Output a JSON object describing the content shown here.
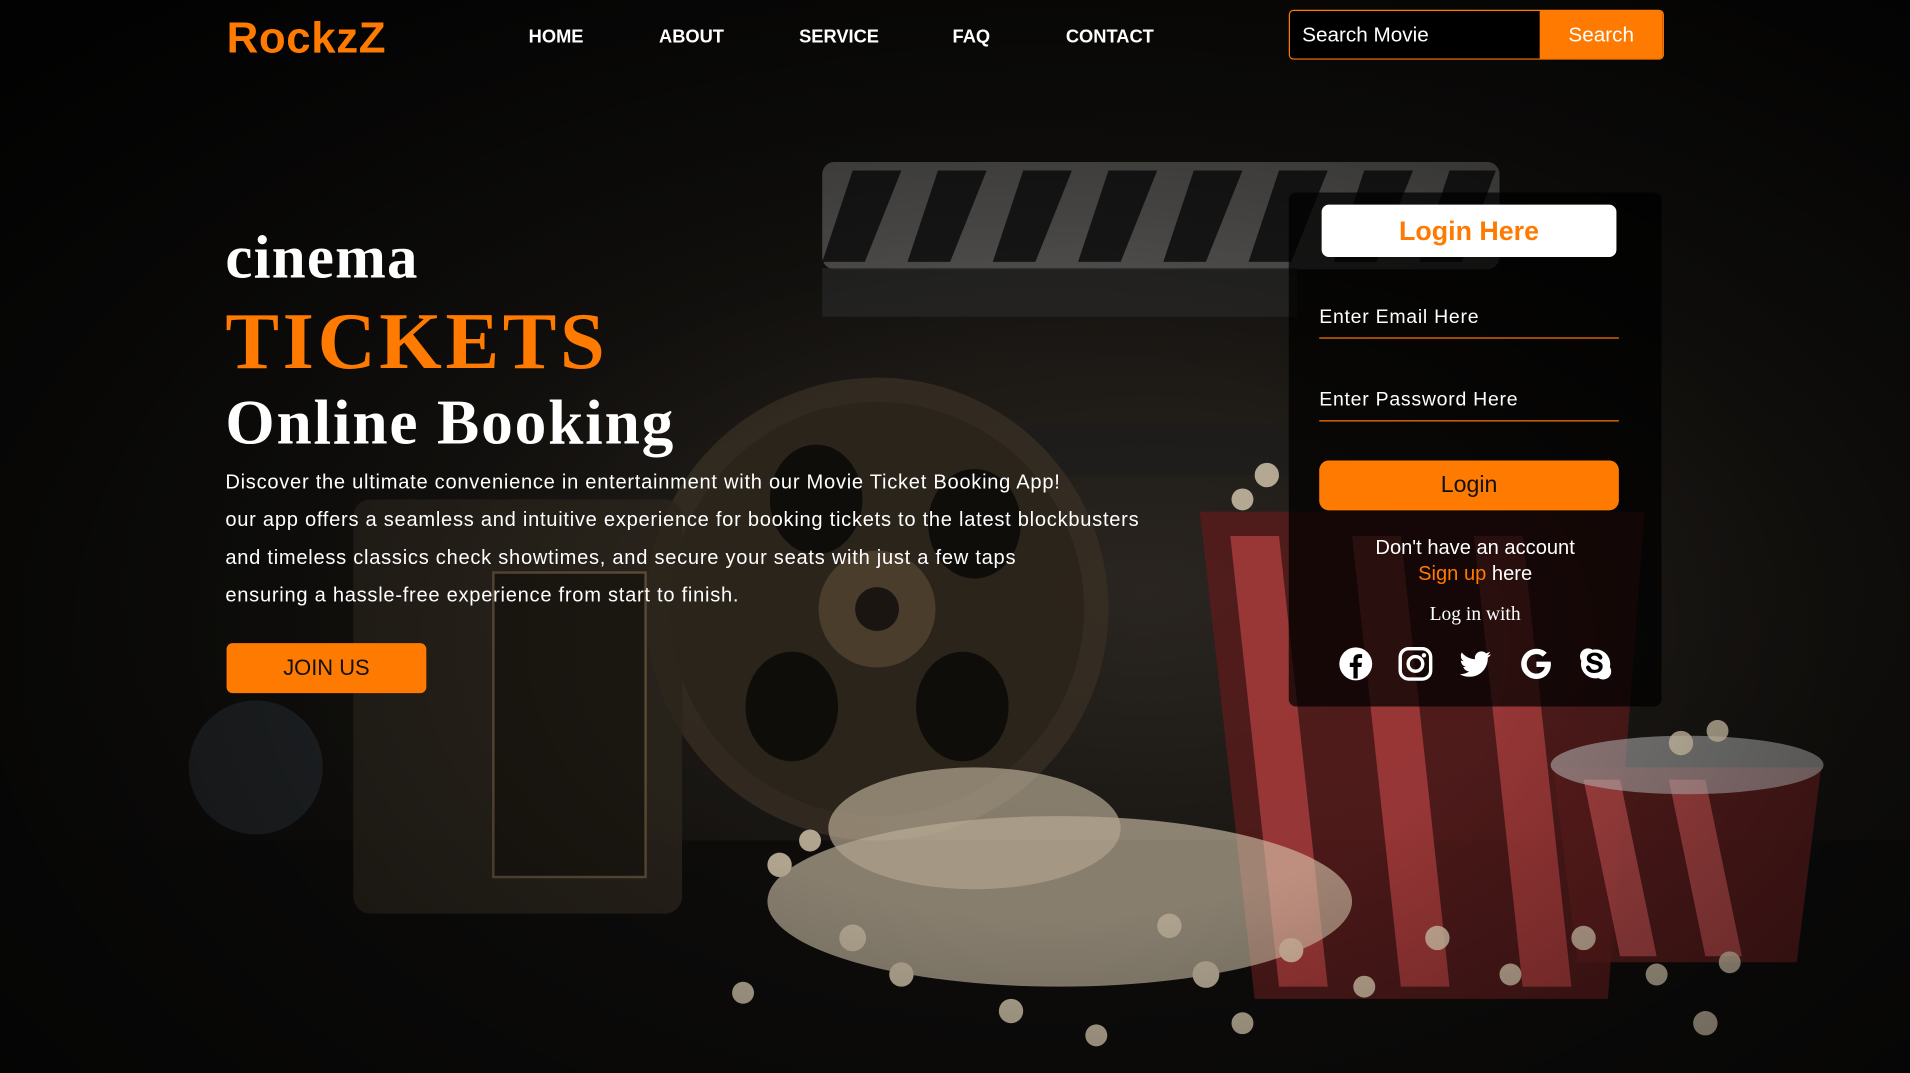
{
  "header": {
    "logo": "RockzZ",
    "nav": [
      "HOME",
      "ABOUT",
      "SERVICE",
      "FAQ",
      "CONTACT"
    ],
    "search": {
      "placeholder": "Search Movie",
      "button_label": "Search"
    }
  },
  "hero": {
    "line1": "cinema",
    "line2": "TICKETS",
    "line3": "Online Booking",
    "description": [
      "Discover the ultimate convenience in entertainment with our Movie Ticket Booking App!",
      "our app offers a seamless and intuitive experience for booking tickets to the latest blockbusters",
      "and timeless classics check showtimes, and secure your seats with just a few taps",
      "ensuring a hassle-free experience from start to finish."
    ],
    "cta_label": "JOIN US"
  },
  "login": {
    "title": "Login Here",
    "email_placeholder": "Enter Email Here",
    "password_placeholder": "Enter Password Here",
    "button_label": "Login",
    "no_account": "Don't have an account",
    "signup_link": "Sign up",
    "signup_suffix": "here",
    "login_with": "Log in with",
    "socials": [
      "facebook",
      "instagram",
      "twitter",
      "google",
      "skype"
    ]
  },
  "colors": {
    "accent": "#ff7a00",
    "background": "#0b0b0b",
    "text": "#ffffff"
  }
}
